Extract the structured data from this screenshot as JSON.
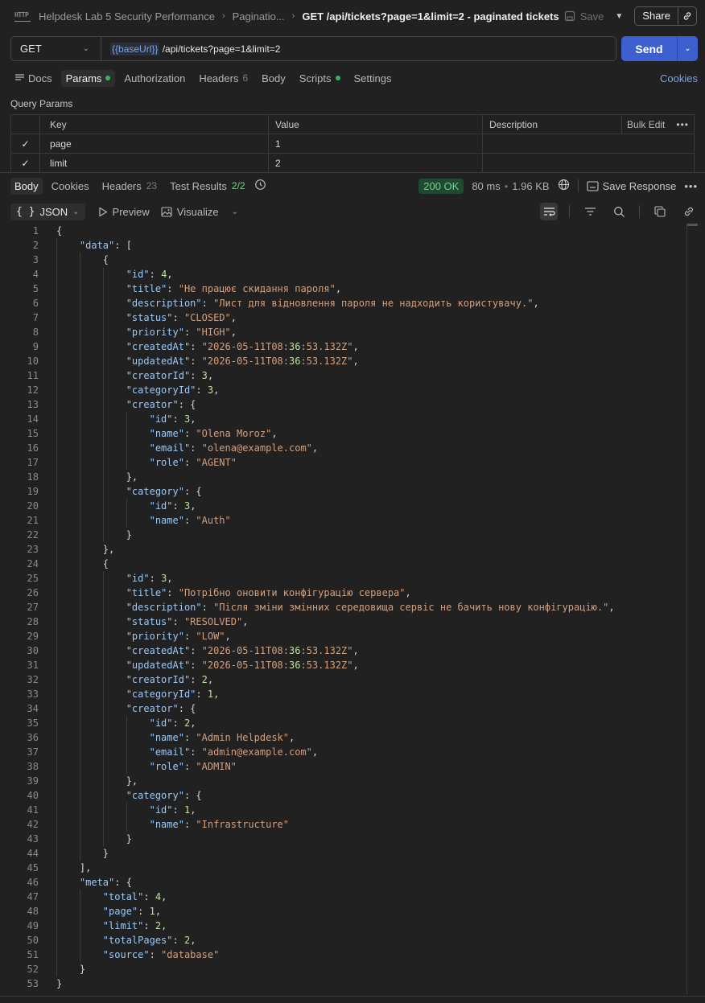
{
  "header": {
    "breadcrumb": [
      "Helpdesk Lab 5 Security Performance",
      "Paginatio..."
    ],
    "current": "GET /api/tickets?page=1&limit=2 - paginated tickets",
    "save_label": "Save",
    "share_label": "Share"
  },
  "request": {
    "method": "GET",
    "url_var": "{{baseUrl}}",
    "url_path": " /api/tickets?page=1&limit=2",
    "send_label": "Send"
  },
  "req_tabs": {
    "docs": "Docs",
    "params": "Params",
    "authorization": "Authorization",
    "headers": "Headers",
    "headers_count": "6",
    "body": "Body",
    "scripts": "Scripts",
    "settings": "Settings",
    "cookies": "Cookies"
  },
  "query_params": {
    "title": "Query Params",
    "columns": {
      "key": "Key",
      "value": "Value",
      "description": "Description",
      "bulk_edit": "Bulk Edit"
    },
    "rows": [
      {
        "key": "page",
        "value": "1",
        "description": ""
      },
      {
        "key": "limit",
        "value": "2",
        "description": ""
      }
    ]
  },
  "response": {
    "tabs": {
      "body": "Body",
      "cookies": "Cookies",
      "headers": "Headers",
      "headers_count": "23",
      "test_results": "Test Results",
      "test_count": "2/2"
    },
    "status": "200 OK",
    "time": "80 ms",
    "size": "1.96 KB",
    "save_response": "Save Response",
    "format": "JSON",
    "preview": "Preview",
    "visualize": "Visualize"
  },
  "json_lines": [
    "{",
    "    \"data\": [",
    "        {",
    "            \"id\": 4,",
    "            \"title\": \"Не працює скидання пароля\",",
    "            \"description\": \"Лист для відновлення пароля не надходить користувачу.\",",
    "            \"status\": \"CLOSED\",",
    "            \"priority\": \"HIGH\",",
    "            \"createdAt\": \"2026-05-11T08:36:53.132Z\",",
    "            \"updatedAt\": \"2026-05-11T08:36:53.132Z\",",
    "            \"creatorId\": 3,",
    "            \"categoryId\": 3,",
    "            \"creator\": {",
    "                \"id\": 3,",
    "                \"name\": \"Olena Moroz\",",
    "                \"email\": \"olena@example.com\",",
    "                \"role\": \"AGENT\"",
    "            },",
    "            \"category\": {",
    "                \"id\": 3,",
    "                \"name\": \"Auth\"",
    "            }",
    "        },",
    "        {",
    "            \"id\": 3,",
    "            \"title\": \"Потрібно оновити конфігурацію сервера\",",
    "            \"description\": \"Після зміни змінних середовища сервіс не бачить нову конфігурацію.\",",
    "            \"status\": \"RESOLVED\",",
    "            \"priority\": \"LOW\",",
    "            \"createdAt\": \"2026-05-11T08:36:53.132Z\",",
    "            \"updatedAt\": \"2026-05-11T08:36:53.132Z\",",
    "            \"creatorId\": 2,",
    "            \"categoryId\": 1,",
    "            \"creator\": {",
    "                \"id\": 2,",
    "                \"name\": \"Admin Helpdesk\",",
    "                \"email\": \"admin@example.com\",",
    "                \"role\": \"ADMIN\"",
    "            },",
    "            \"category\": {",
    "                \"id\": 1,",
    "                \"name\": \"Infrastructure\"",
    "            }",
    "        }",
    "    ],",
    "    \"meta\": {",
    "        \"total\": 4,",
    "        \"page\": 1,",
    "        \"limit\": 2,",
    "        \"totalPages\": 2,",
    "        \"source\": \"database\"",
    "    }",
    "}"
  ]
}
